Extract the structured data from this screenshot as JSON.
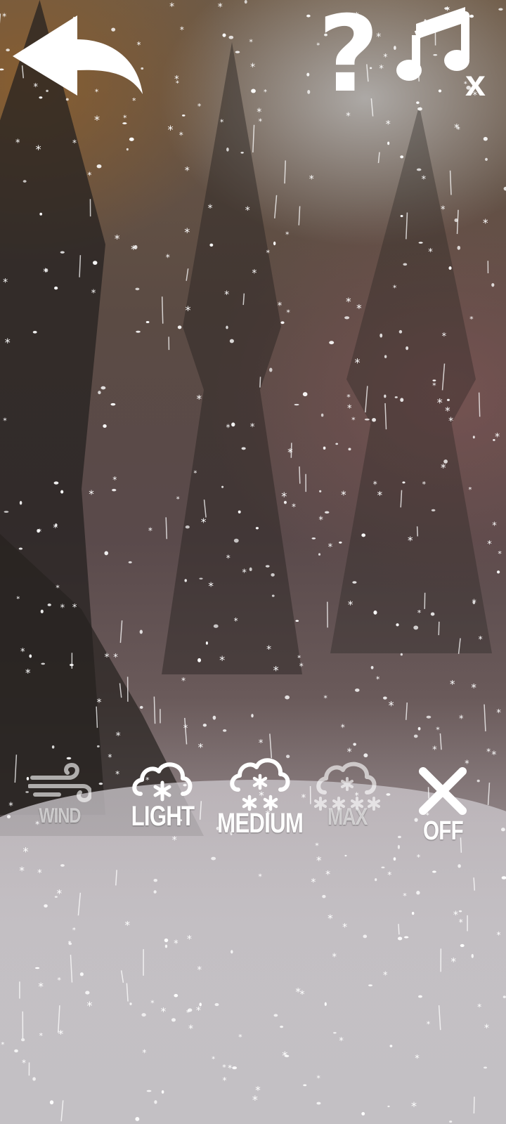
{
  "toolbar": {
    "back_icon": "back-arrow-icon",
    "help_icon": "question-mark-icon",
    "help_glyph": "?",
    "music_icon": "music-note-muted-icon",
    "music_glyph": "♫",
    "mute_mark": "x"
  },
  "controls": [
    {
      "key": "wind",
      "label": "WIND",
      "icon": "wind-icon",
      "state": "dim"
    },
    {
      "key": "light",
      "label": "LIGHT",
      "icon": "cloud-snow-light-icon",
      "state": "active"
    },
    {
      "key": "medium",
      "label": "MEDIUM",
      "icon": "cloud-snow-medium-icon",
      "state": "active"
    },
    {
      "key": "max",
      "label": "MAX",
      "icon": "cloud-snow-max-icon",
      "state": "dim"
    },
    {
      "key": "off",
      "label": "OFF",
      "icon": "close-icon",
      "state": "active"
    }
  ],
  "colors": {
    "icon": "#ffffff",
    "dim_icon": "#bdbdbd"
  }
}
